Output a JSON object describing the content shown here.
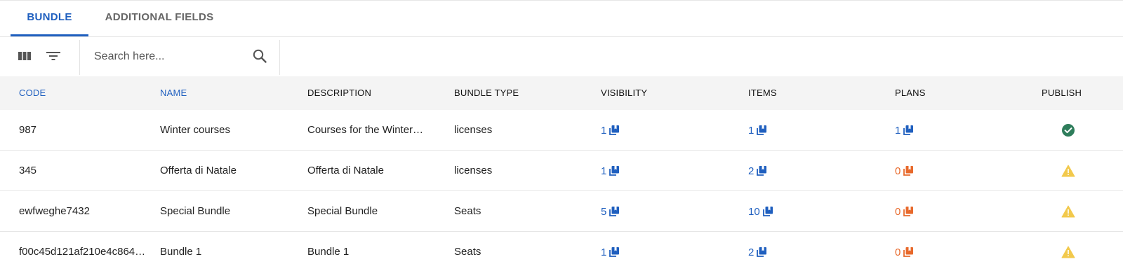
{
  "tabs": [
    {
      "label": "BUNDLE",
      "active": true
    },
    {
      "label": "ADDITIONAL FIELDS",
      "active": false
    }
  ],
  "toolbar": {
    "columns_icon": "columns-icon",
    "filter_icon": "filter-icon",
    "search_icon": "search-icon",
    "search_placeholder": "Search here..."
  },
  "table": {
    "headers": {
      "code": "CODE",
      "name": "NAME",
      "description": "DESCRIPTION",
      "bundle_type": "BUNDLE TYPE",
      "visibility": "VISIBILITY",
      "items": "ITEMS",
      "plans": "PLANS",
      "publish": "PUBLISH"
    },
    "rows": [
      {
        "code": "987",
        "name": "Winter courses",
        "description": "Courses for the Winter…",
        "bundle_type": "licenses",
        "visibility": "1",
        "items": "1",
        "plans": "1",
        "publish": "published"
      },
      {
        "code": "345",
        "name": "Offerta di Natale",
        "description": "Offerta di Natale",
        "bundle_type": "licenses",
        "visibility": "1",
        "items": "2",
        "plans": "0",
        "publish": "warning"
      },
      {
        "code": "ewfweghe7432",
        "name": "Special Bundle",
        "description": "Special Bundle",
        "bundle_type": "Seats",
        "visibility": "5",
        "items": "10",
        "plans": "0",
        "publish": "warning"
      },
      {
        "code": "f00c45d121af210e4c864…",
        "name": "Bundle 1",
        "description": "Bundle 1",
        "bundle_type": "Seats",
        "visibility": "1",
        "items": "2",
        "plans": "0",
        "publish": "warning"
      }
    ]
  },
  "colors": {
    "accent_blue": "#1f5fbf",
    "zero_orange": "#e8692b",
    "published_green": "#2e7d5b",
    "warning_yellow": "#f2c94c"
  }
}
